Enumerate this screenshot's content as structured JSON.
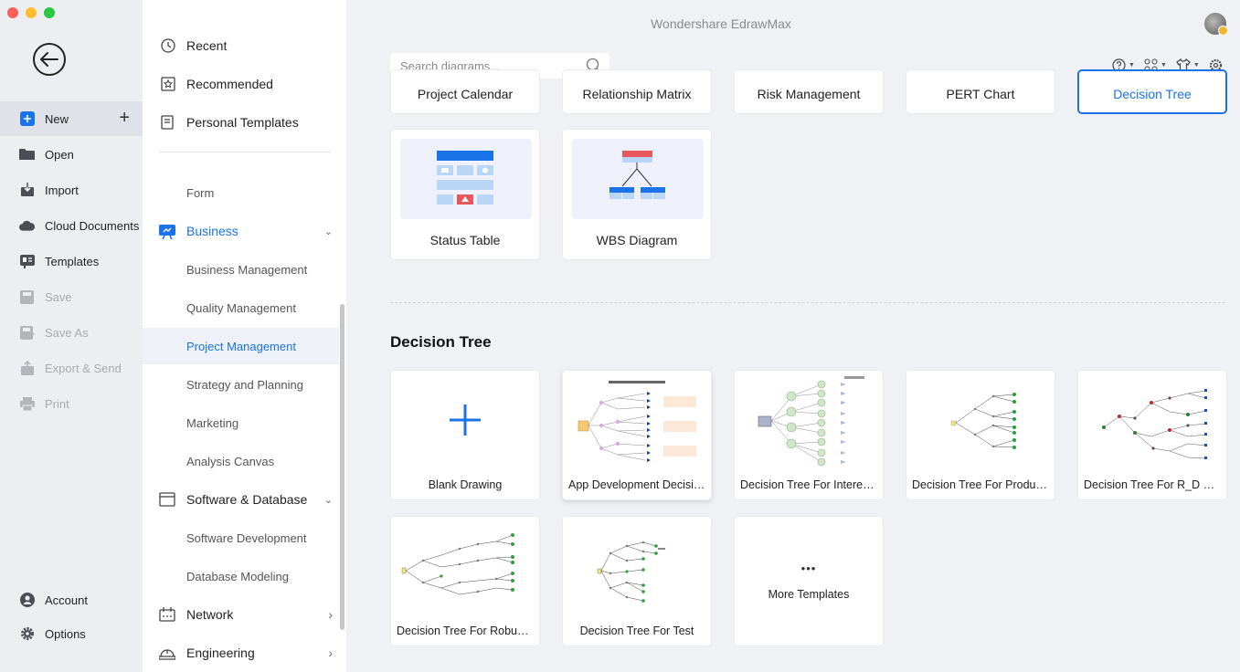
{
  "app": {
    "title": "Wondershare EdrawMax"
  },
  "rail": {
    "items": [
      {
        "label": "New",
        "icon": "plus-square-icon"
      },
      {
        "label": "Open",
        "icon": "folder-icon"
      },
      {
        "label": "Import",
        "icon": "import-icon"
      },
      {
        "label": "Cloud Documents",
        "icon": "cloud-icon"
      },
      {
        "label": "Templates",
        "icon": "templates-icon"
      },
      {
        "label": "Save",
        "icon": "save-icon"
      },
      {
        "label": "Save As",
        "icon": "save-as-icon"
      },
      {
        "label": "Export & Send",
        "icon": "export-icon"
      },
      {
        "label": "Print",
        "icon": "print-icon"
      }
    ],
    "account": "Account",
    "options": "Options"
  },
  "categories": {
    "top": [
      "Recent",
      "Recommended",
      "Personal Templates"
    ],
    "form": "Form",
    "business": {
      "label": "Business",
      "items": [
        "Business Management",
        "Quality Management",
        "Project Management",
        "Strategy and Planning",
        "Marketing",
        "Analysis Canvas"
      ]
    },
    "software": {
      "label": "Software & Database",
      "items": [
        "Software Development",
        "Database Modeling"
      ]
    },
    "network": "Network",
    "engineering": "Engineering"
  },
  "search": {
    "placeholder": "Search diagrams..."
  },
  "diagram_types": {
    "row1": [
      "Project Calendar",
      "Relationship Matrix",
      "Risk Management",
      "PERT Chart",
      "Decision Tree"
    ],
    "row2": [
      "Status Table",
      "WBS Diagram"
    ]
  },
  "section": {
    "title": "Decision Tree",
    "templates": [
      "Blank Drawing",
      "App Development Decision Tree",
      "Decision Tree For Interest Rate",
      "Decision Tree For Product Launch",
      "Decision Tree For R_D Project",
      "Decision Tree For Robust Design",
      "Decision Tree For Test",
      "More Templates"
    ],
    "more_dots": "•••"
  },
  "colors": {
    "accent": "#1a73e8",
    "red": "#e8575c",
    "light_blue": "#b9d6f7"
  }
}
